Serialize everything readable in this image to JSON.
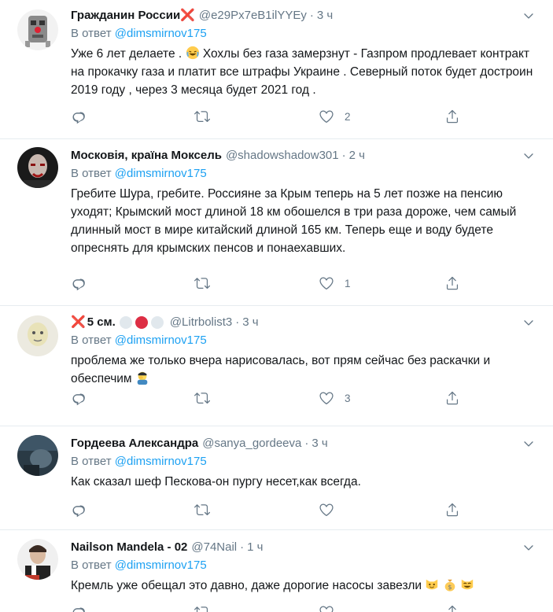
{
  "tweets": [
    {
      "name": "Гражданин России",
      "name_suffix": "❌",
      "handle": "@e29Px7eB1ilYYEy",
      "dot": "·",
      "time": "3 ч",
      "reply_prefix": "В ответ",
      "reply_to": "@dimsmirnov175",
      "text_a": "Уже 6 лет делаете .",
      "emoji_1": "joy-emoji",
      "text_b": " Хохлы без газа замерзнут - Газпром продлевает контракт на прокачку газа и платит все штрафы Украине . Северный поток будет достроин 2019 году , через 3 месяца будет 2021 год .",
      "likes": "2"
    },
    {
      "name": "Московія, країна Моксель",
      "handle": "@shadowshadow301",
      "dot": "·",
      "time": "2 ч",
      "reply_prefix": "В ответ",
      "reply_to": "@dimsmirnov175",
      "text": "Гребите Шура, гребите. Россияне за Крым теперь на 5 лет позже на пенсию уходят; Крымский мост длиной 18 км обошелся в три раза дороже, чем самый длинный мост в мире китайский длиной 165 км. Теперь еще и воду будете опреснять для крымских пенсов и понаехавших.",
      "likes": "1"
    },
    {
      "name_prefix": "❌",
      "name": "5 см.",
      "name_emojis": [
        "white-circle",
        "red-circle",
        "white-circle"
      ],
      "handle": "@Litrbolist3",
      "dot": "·",
      "time": "3 ч",
      "reply_prefix": "В ответ",
      "reply_to": "@dimsmirnov175",
      "text": "проблема же только вчера нарисовалась, вот прям сейчас без раскачки и обеспечим",
      "emoji_1": "man-facepalming-emoji",
      "likes": "3"
    },
    {
      "name": "Гордеева Александра",
      "handle": "@sanya_gordeeva",
      "dot": "·",
      "time": "3 ч",
      "reply_prefix": "В ответ",
      "reply_to": "@dimsmirnov175",
      "text": "Как сказал шеф Пескова-он пургу несет,как всегда.",
      "likes": ""
    },
    {
      "name": "Nailson Mandela - 02",
      "handle": "@74Nail",
      "dot": "·",
      "time": "1 ч",
      "reply_prefix": "В ответ",
      "reply_to": "@dimsmirnov175",
      "text": "Кремль уже обещал это давно, даже дорогие насосы завезли",
      "emojis": [
        "cat-emoji",
        "money-bag-emoji",
        "grinning-cat-emoji"
      ]
    }
  ],
  "colors": {
    "link": "#1da1f2",
    "secondary": "#657786",
    "divider": "#e6ecf0",
    "danger": "#e0245e"
  }
}
